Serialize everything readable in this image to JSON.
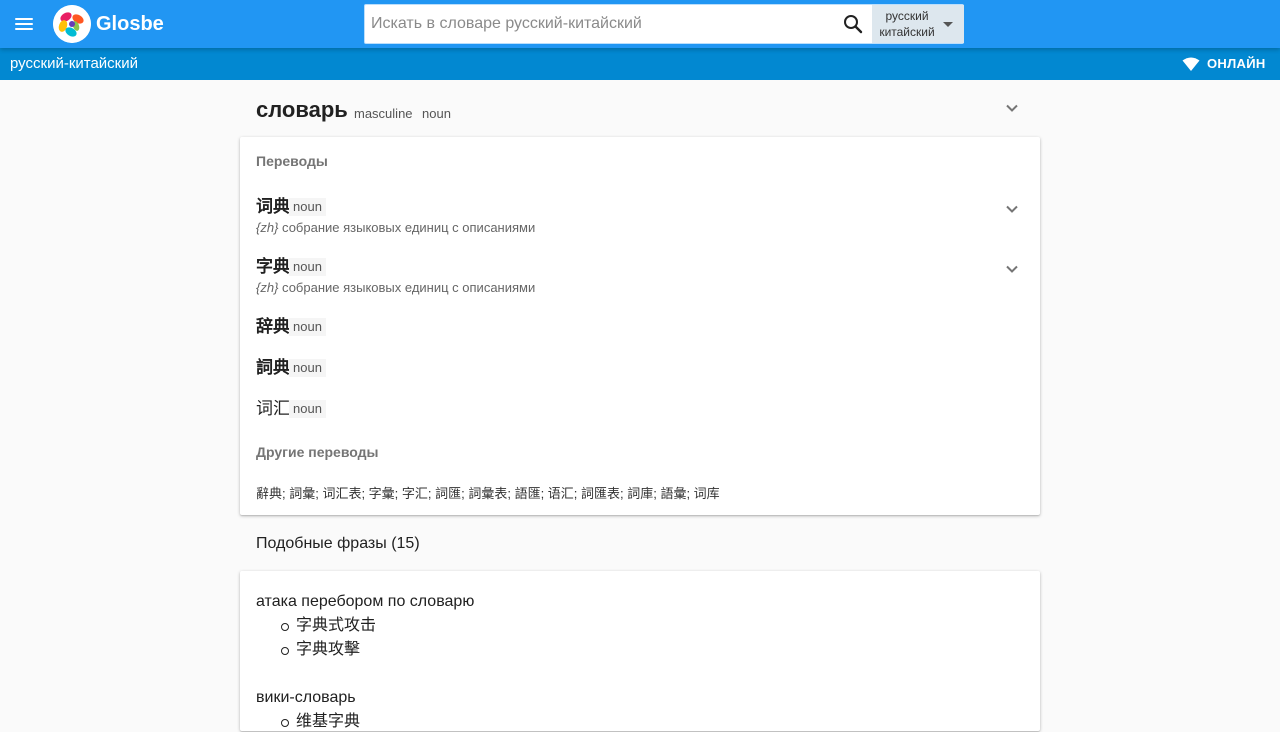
{
  "header": {
    "brand": "Glosbe",
    "search_placeholder": "Искать в словаре русский-китайский",
    "lang_from": "русский",
    "lang_to": "китайский"
  },
  "subheader": {
    "pair": "русский-китайский",
    "online_label": "ОНЛАЙН"
  },
  "entry": {
    "headword": "словарь",
    "gender": "masculine",
    "pos": "noun"
  },
  "translations": {
    "title": "Переводы",
    "items": [
      {
        "word": "词典",
        "pos": "noun",
        "lang": "{zh}",
        "desc": "собрание языковых единиц с описаниями"
      },
      {
        "word": "字典",
        "pos": "noun",
        "lang": "{zh}",
        "desc": "собрание языковых единиц с описаниями"
      },
      {
        "word": "辞典",
        "pos": "noun"
      },
      {
        "word": "詞典",
        "pos": "noun"
      },
      {
        "word": "词汇",
        "pos": "noun"
      }
    ],
    "other_title": "Другие переводы",
    "other": "辭典; 詞彙; 词汇表; 字彙; 字汇; 詞匯; 詞彙表; 語匯; 语汇; 詞匯表; 詞庫; 語彙; 词库"
  },
  "phrases": {
    "title": "Подобные фразы (15)",
    "items": [
      {
        "phrase": "атака перебором по словарю",
        "translations": [
          "字典式攻击",
          "字典攻擊"
        ]
      },
      {
        "phrase": "вики-словарь",
        "translations": [
          "维基字典"
        ]
      }
    ]
  },
  "colors": {
    "topbar": "#2196f3",
    "subbar": "#0288d1"
  }
}
